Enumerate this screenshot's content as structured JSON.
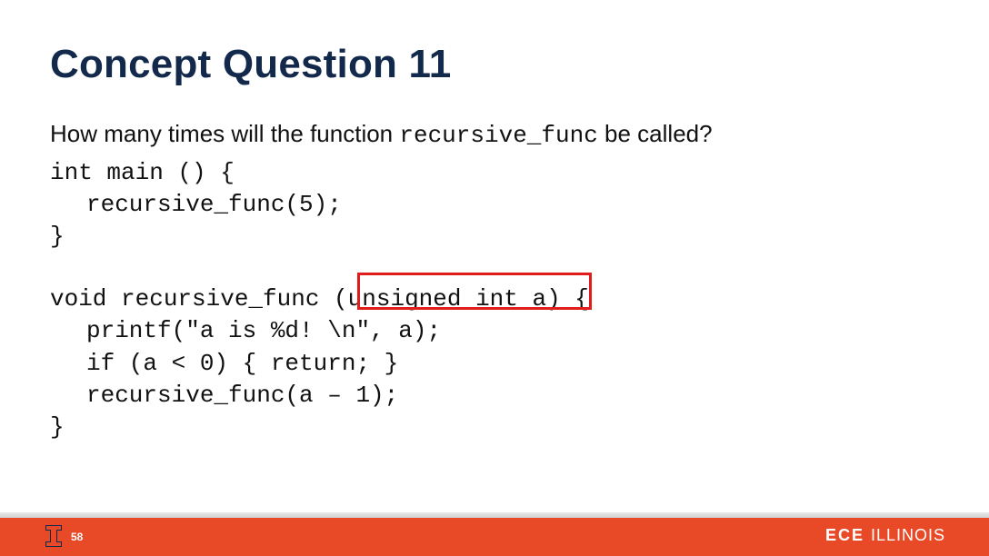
{
  "slide": {
    "title": "Concept Question 11",
    "question_prefix": "How many times will the function ",
    "question_code": "recursive_func",
    "question_suffix": " be called?",
    "code": {
      "l1": "int main () {",
      "l2": "recursive_func(5);",
      "l3": "}",
      "l4": "void recursive_func (unsigned int a) {",
      "l5": "printf(\"a is %d! \\n\", a);",
      "l6": "if (a < 0) { return; }",
      "l7": "recursive_func(a – 1);",
      "l8": "}"
    },
    "highlight_text": "unsigned int a"
  },
  "footer": {
    "page_number": "58",
    "brand_bold": "ECE",
    "brand_light": "ILLINOIS",
    "logo_name": "illinois-block-i-logo"
  },
  "colors": {
    "title": "#12294b",
    "accent": "#e84a27",
    "highlight_border": "#e21b1b"
  }
}
